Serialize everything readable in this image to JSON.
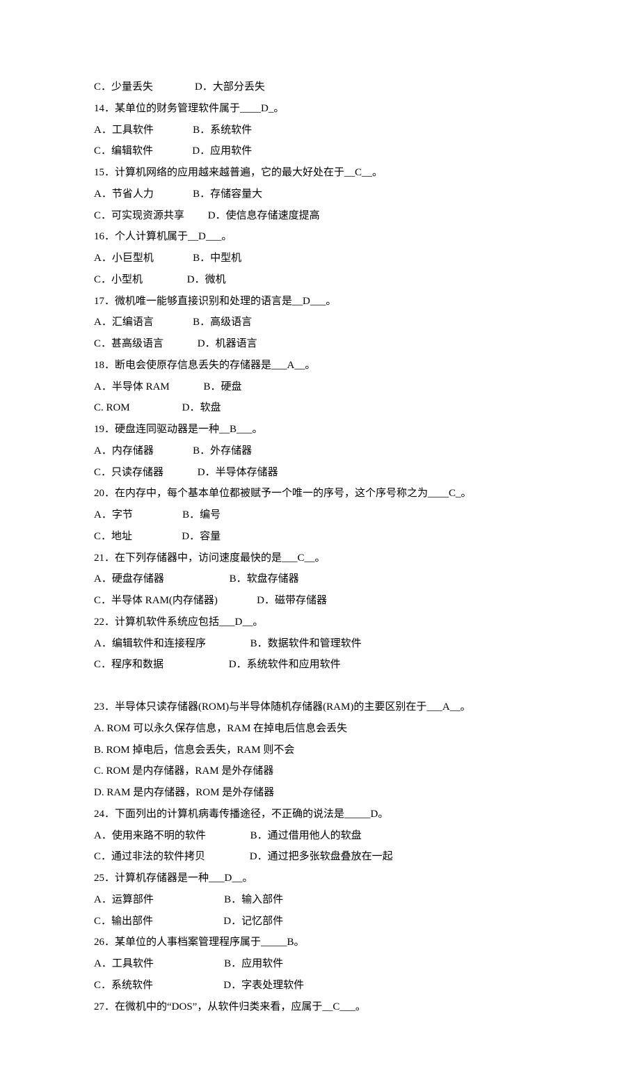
{
  "lines": [
    "C．少量丢失                D．大部分丢失",
    "14．某单位的财务管理软件属于____D_。",
    "A．工具软件               B．系统软件",
    "C．编辑软件               D．应用软件",
    "15．计算机网络的应用越来越普遍，它的最大好处在于__C__。",
    "A．节省人力               B．存储容量大",
    "C．可实现资源共享         D．使信息存储速度提高",
    "16．个人计算机属于__D___。",
    "A．小巨型机               B．中型机",
    "C．小型机                 D．微机",
    "17．微机唯一能够直接识别和处理的语言是__D___。",
    "A．汇编语言               B．高级语言",
    "C．甚高级语言             D．机器语言",
    "18．断电会使原存信息丢失的存储器是___A__。",
    "A．半导体 RAM             B．硬盘",
    "C. ROM                    D．软盘",
    "19．硬盘连同驱动器是一种__B___。",
    "A．内存储器               B．外存储器",
    "C．只读存储器             D．半导体存储器",
    "20．在内存中，每个基本单位都被赋予一个唯一的序号，这个序号称之为____C_。",
    "A．字节                   B．编号",
    "C．地址                   D．容量",
    "21．在下列存储器中，访问速度最快的是___C__。",
    "A．硬盘存储器                         B．软盘存储器",
    "C．半导体 RAM(内存储器)               D．磁带存储器",
    "22．计算机软件系统应包括___D__。",
    "A．编辑软件和连接程序                 B．数据软件和管理软件",
    "C．程序和数据                         D．系统软件和应用软件",
    "",
    "23．半导体只读存储器(ROM)与半导体随机存储器(RAM)的主要区别在于___A__。",
    "A. ROM 可以永久保存信息，RAM 在掉电后信息会丢失",
    "B. ROM 掉电后，信息会丢失，RAM 则不会",
    "C. ROM 是内存储器，RAM 是外存储器",
    "D. RAM 是内存储器，ROM 是外存储器",
    "24．下面列出的计算机病毒传播途径，不正确的说法是_____D。",
    "A．使用来路不明的软件                 B．通过借用他人的软盘",
    "C．通过非法的软件拷贝                 D．通过把多张软盘叠放在一起",
    "25．计算机存储器是一种___D__。",
    "A．运算部件                           B．输入部件",
    "C．输出部件                           D．记忆部件",
    "26．某单位的人事档案管理程序属于_____B。",
    "A．工具软件                           B．应用软件",
    "C．系统软件                           D．字表处理软件",
    "27．在微机中的“DOS”，从软件归类来看，应属于__C___。"
  ]
}
